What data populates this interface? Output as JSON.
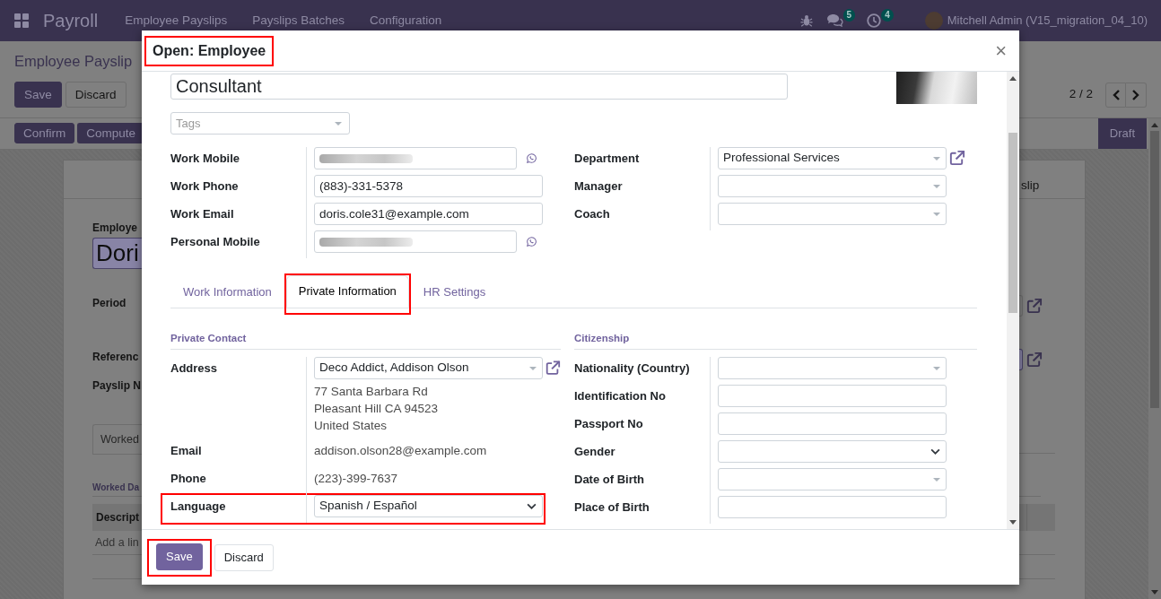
{
  "navbar": {
    "app_name": "Payroll",
    "menu": [
      "Employee Payslips",
      "Payslips Batches",
      "Configuration"
    ],
    "notifications": [
      {
        "kind": "chat",
        "count": "5"
      },
      {
        "kind": "activity",
        "count": "4"
      }
    ],
    "user": "Mitchell Admin (V15_migration_04_10)"
  },
  "control_panel": {
    "breadcrumb": "Employee Payslip",
    "buttons": [
      {
        "label": "Save",
        "kind": "primary"
      },
      {
        "label": "Discard",
        "kind": "secondary"
      }
    ],
    "pager": "2 / 2"
  },
  "status_bar": {
    "buttons": [
      {
        "label": "Confirm",
        "kind": "primary"
      },
      {
        "label": "Compute",
        "kind": "primary"
      }
    ],
    "stages": [
      {
        "label": "Draft",
        "selected": true
      }
    ]
  },
  "sheet": {
    "smart_button": "slip",
    "employee": {
      "label": "Employe",
      "value": "Dori",
      "required": true
    },
    "fields": [
      "Period",
      "Referenc",
      "Payslip N"
    ],
    "side_fields": [
      {
        "required": false
      },
      {
        "required": true
      }
    ],
    "tabs": [
      {
        "label": "Worked",
        "selected": true
      }
    ],
    "section_title": "Worked Da",
    "table": {
      "columns": [
        "Descript"
      ],
      "add_line": "Add a lin"
    }
  },
  "dialog": {
    "title": "Open: Employee",
    "highlighted": true,
    "close": "×",
    "job_title": "Consultant",
    "tags": {
      "placeholder": "Tags"
    },
    "contact_fields": [
      {
        "label": "Work Mobile",
        "kind": "mobile",
        "redacted": true
      },
      {
        "label": "Work Phone",
        "kind": "text",
        "value": "(883)-331-5378",
        "redacted": false
      },
      {
        "label": "Work Email",
        "kind": "text",
        "value": "doris.cole31@example.com",
        "redacted": false
      },
      {
        "label": "Personal Mobile",
        "kind": "mobile",
        "redacted": true
      }
    ],
    "org_fields": [
      {
        "label": "Department",
        "kind": "many2one",
        "value": "Professional Services",
        "external_link": true
      },
      {
        "label": "Manager",
        "kind": "many2one",
        "external_link": false
      },
      {
        "label": "Coach",
        "kind": "many2one",
        "external_link": false
      }
    ],
    "tabs": [
      {
        "label": "Work Information",
        "selected": false,
        "highlighted": false
      },
      {
        "label": "Private Information",
        "selected": true,
        "highlighted": true
      },
      {
        "label": "HR Settings",
        "selected": false,
        "highlighted": false
      }
    ],
    "private_contact": {
      "title": "Private Contact",
      "fields": [
        {
          "label": "Address",
          "kind": "many2one",
          "value": "Deco Addict, Addison Olson",
          "external_link": true,
          "address_lines": [
            "77 Santa Barbara Rd",
            "Pleasant Hill CA 94523",
            "United States"
          ],
          "highlighted": false
        },
        {
          "label": "Email",
          "kind": "readonly",
          "value": "addison.olson28@example.com",
          "external_link": false,
          "highlighted": false
        },
        {
          "label": "Phone",
          "kind": "readonly",
          "value": "(223)-399-7637",
          "external_link": false,
          "highlighted": false
        },
        {
          "label": "Language",
          "kind": "select",
          "value": "Spanish / Español",
          "external_link": false,
          "highlighted": true
        }
      ]
    },
    "citizenship": {
      "title": "Citizenship",
      "fields": [
        {
          "label": "Nationality (Country)",
          "kind": "many2one"
        },
        {
          "label": "Identification No",
          "kind": "text"
        },
        {
          "label": "Passport No",
          "kind": "text"
        },
        {
          "label": "Gender",
          "kind": "select"
        },
        {
          "label": "Date of Birth",
          "kind": "date"
        },
        {
          "label": "Place of Birth",
          "kind": "text"
        }
      ]
    },
    "footer_buttons": [
      {
        "label": "Save",
        "kind": "primary",
        "highlighted": true
      },
      {
        "label": "Discard",
        "kind": "secondary",
        "highlighted": false
      }
    ]
  }
}
